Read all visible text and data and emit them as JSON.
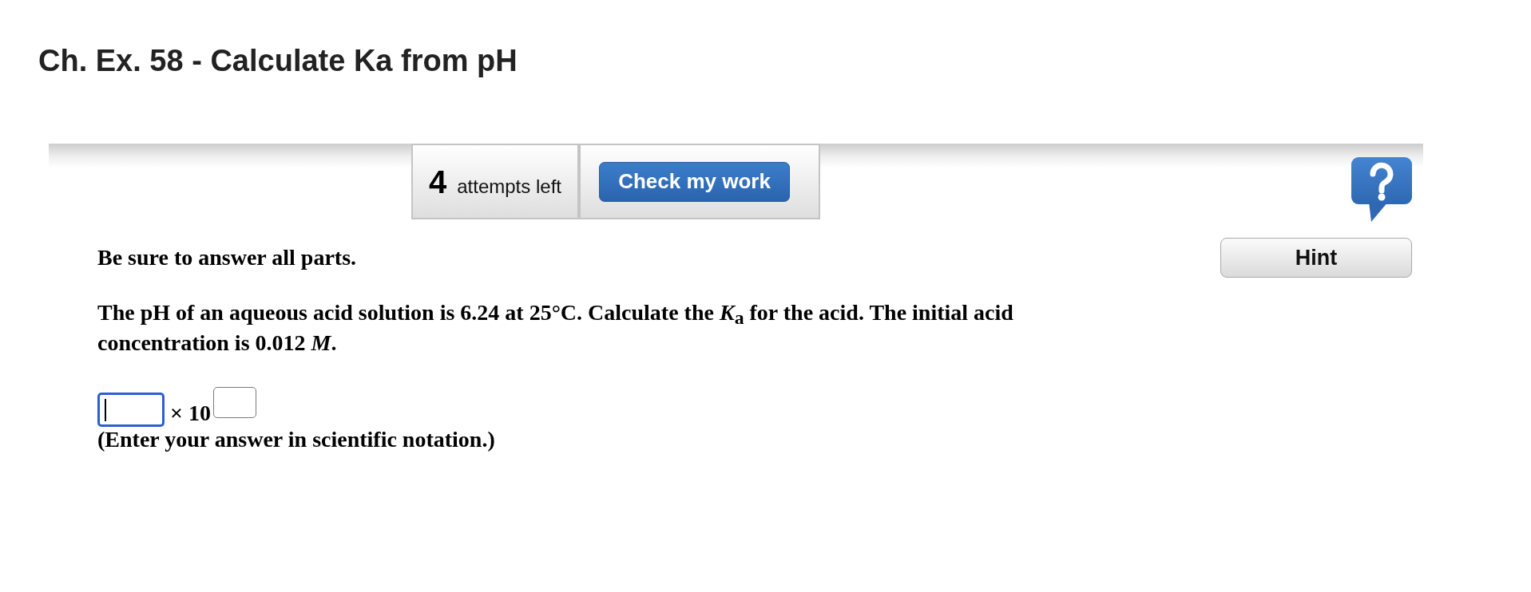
{
  "title": "Ch. Ex. 58 - Calculate Ka from pH",
  "toolbar": {
    "attempts": {
      "count": "4",
      "label": "attempts left"
    },
    "check_button": "Check my work"
  },
  "hint_button": "Hint",
  "instruction": "Be sure to answer all parts.",
  "question": "The pH of an aqueous acid solution is 6.24 at 25°C. Calculate the *K*$_{a}$ for the acid. The initial acid concentration is 0.012 *M*.",
  "answer": {
    "mantissa": {
      "focused": true
    },
    "times_ten": "× 10",
    "exponent": {
      "focused": false
    },
    "note": "(Enter your answer in scientific notation.)"
  }
}
